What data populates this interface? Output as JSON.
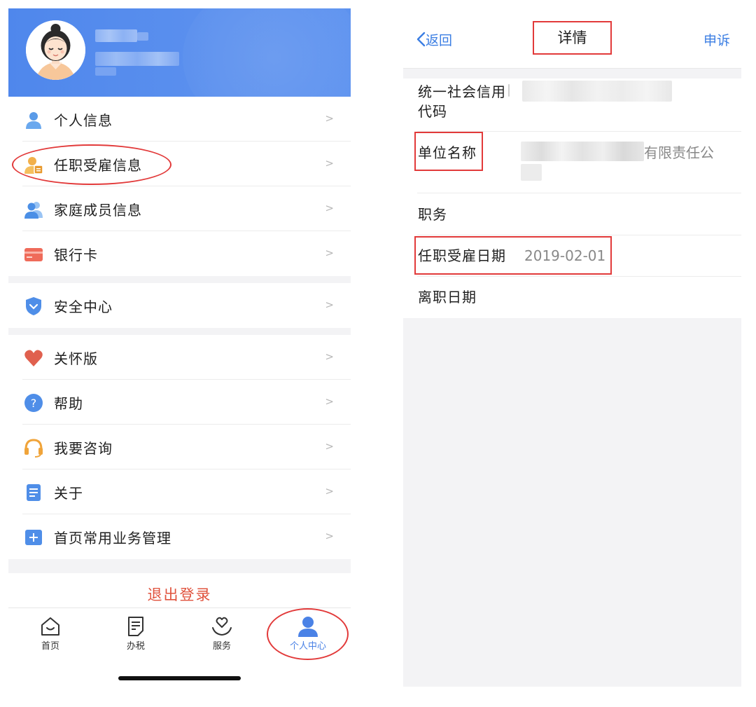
{
  "left": {
    "menu_group1": [
      {
        "label": "个人信息",
        "icon": "user-icon"
      },
      {
        "label": "任职受雇信息",
        "icon": "employee-badge-icon"
      },
      {
        "label": "家庭成员信息",
        "icon": "family-icon"
      },
      {
        "label": "银行卡",
        "icon": "bank-card-icon"
      }
    ],
    "menu_group2": [
      {
        "label": "安全中心",
        "icon": "shield-icon"
      }
    ],
    "menu_group3": [
      {
        "label": "关怀版",
        "icon": "heart-icon"
      },
      {
        "label": "帮助",
        "icon": "help-icon"
      },
      {
        "label": "我要咨询",
        "icon": "headset-icon"
      },
      {
        "label": "关于",
        "icon": "document-icon"
      },
      {
        "label": "首页常用业务管理",
        "icon": "grid-plus-icon"
      }
    ],
    "chevron": ">",
    "logout_label": "退出登录",
    "tabs": [
      {
        "label": "首页",
        "icon": "home-icon",
        "active": false
      },
      {
        "label": "办税",
        "icon": "tax-form-icon",
        "active": false
      },
      {
        "label": "服务",
        "icon": "heart-hand-icon",
        "active": false
      },
      {
        "label": "个人中心",
        "icon": "person-icon",
        "active": true
      }
    ],
    "colors": {
      "header": "#5089ec",
      "accent": "#4a82e6",
      "logout": "#e0533e",
      "annotation": "#e23a3a"
    }
  },
  "right": {
    "nav": {
      "back_label": "返回",
      "title": "详情",
      "appeal_label": "申诉"
    },
    "fields": {
      "credit_code_label": "统一社会信用代码",
      "company_name_label": "单位名称",
      "company_name_visible": "有限责任公",
      "position_label": "职务",
      "hire_date_label": "任职受雇日期",
      "hire_date_value": "2019-02-01",
      "leave_date_label": "离职日期"
    }
  }
}
